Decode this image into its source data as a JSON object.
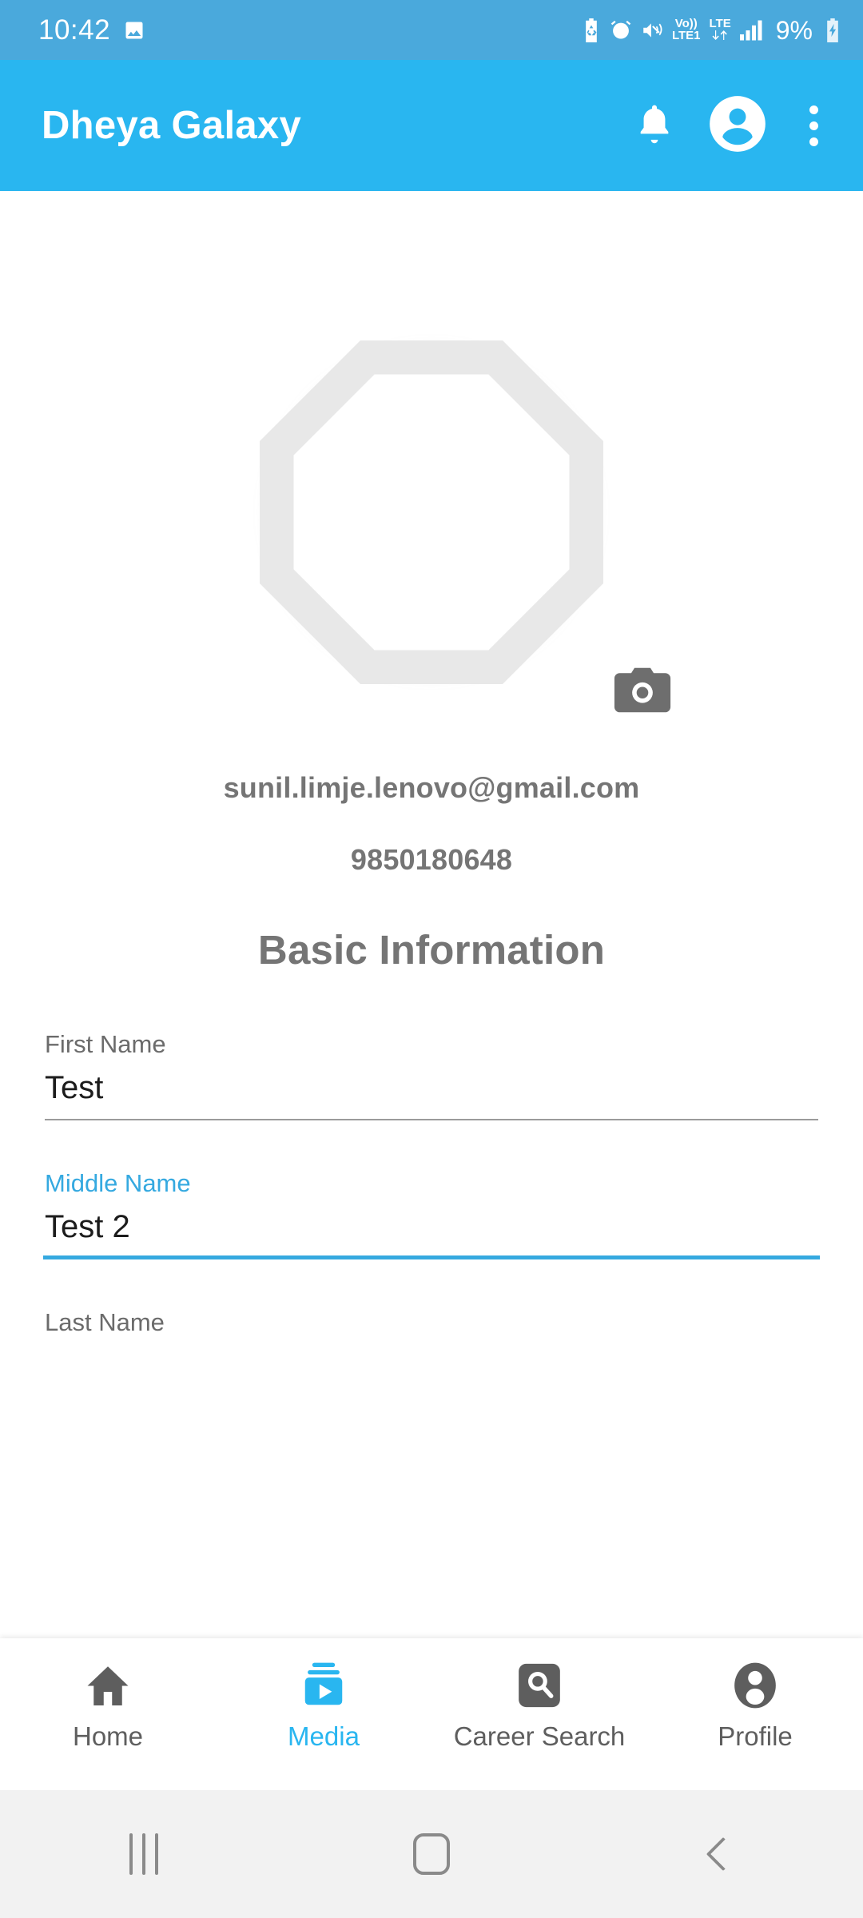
{
  "status_bar": {
    "time": "10:42",
    "icons": [
      "image-icon",
      "battery-saver-icon",
      "alarm-icon",
      "vibrate-mute-icon",
      "volte-icon",
      "lte-data-icon",
      "signal-bars-icon",
      "battery-charging-icon"
    ],
    "volte_top": "Vo))",
    "volte_bottom": "LTE1",
    "lte_label": "LTE",
    "battery_percent": "9%"
  },
  "app_bar": {
    "title": "Dheya Galaxy",
    "notification_icon": "bell-icon",
    "account_icon": "account-circle-icon",
    "overflow_icon": "more-vert-icon",
    "background": "#29b6f0"
  },
  "profile": {
    "avatar_placeholder": "octagon-avatar-placeholder",
    "camera_button": "camera-icon",
    "email": "sunil.limje.lenovo@gmail.com",
    "phone": "9850180648"
  },
  "section": {
    "title": "Basic Information"
  },
  "form": {
    "fields": [
      {
        "label": "First Name",
        "value": "Test",
        "focused": false
      },
      {
        "label": "Middle Name",
        "value": "Test 2",
        "focused": true
      },
      {
        "label": "Last Name",
        "value": "",
        "focused": false
      }
    ]
  },
  "bottom_nav": {
    "active_index": 1,
    "active_color": "#29b6f0",
    "inactive_color": "#5e5e5e",
    "items": [
      {
        "label": "Home",
        "icon": "home-icon"
      },
      {
        "label": "Media",
        "icon": "video-library-icon"
      },
      {
        "label": "Career Search",
        "icon": "search-box-icon"
      },
      {
        "label": "Profile",
        "icon": "account-icon"
      }
    ]
  },
  "system_nav": {
    "recents": "recents-icon",
    "home": "home-square-icon",
    "back": "back-chevron-icon"
  }
}
